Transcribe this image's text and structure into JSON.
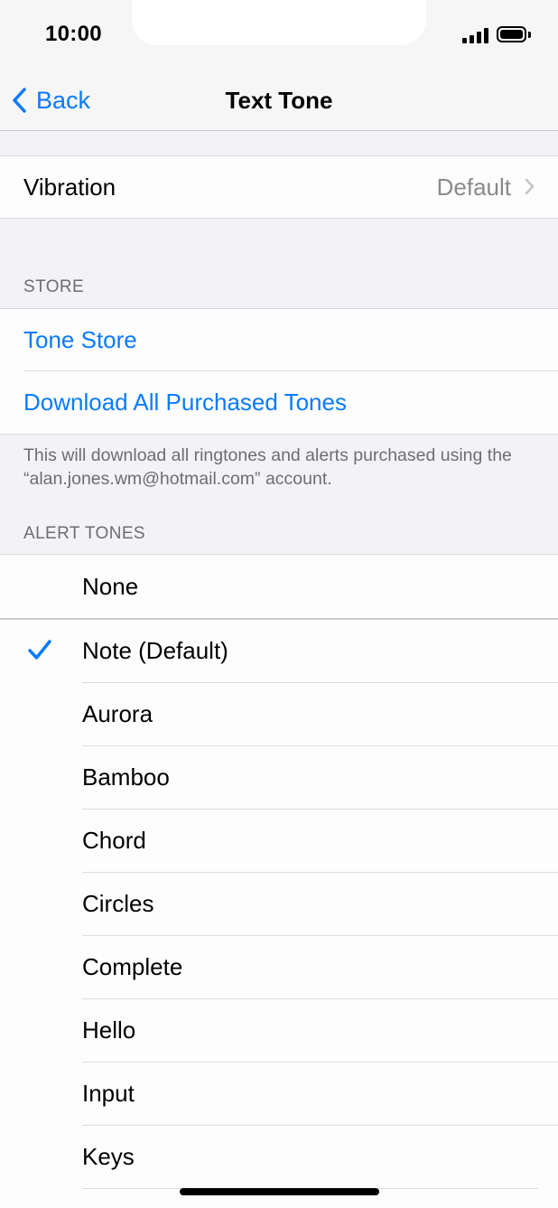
{
  "status_bar": {
    "time": "10:00"
  },
  "nav": {
    "back_label": "Back",
    "title": "Text Tone"
  },
  "vibration": {
    "label": "Vibration",
    "value": "Default"
  },
  "store": {
    "header": "STORE",
    "tone_store": "Tone Store",
    "download_all": "Download All Purchased Tones",
    "footer": "This will download all ringtones and alerts purchased using the “alan.jones.wm@hotmail.com” account."
  },
  "alert_tones": {
    "header": "ALERT TONES",
    "none": "None",
    "items": [
      "Note (Default)",
      "Aurora",
      "Bamboo",
      "Chord",
      "Circles",
      "Complete",
      "Hello",
      "Input",
      "Keys"
    ],
    "selected_index": 0
  },
  "colors": {
    "accent": "#0a7aff",
    "background": "#f2f2f7",
    "secondary_text": "#6d6d72"
  }
}
